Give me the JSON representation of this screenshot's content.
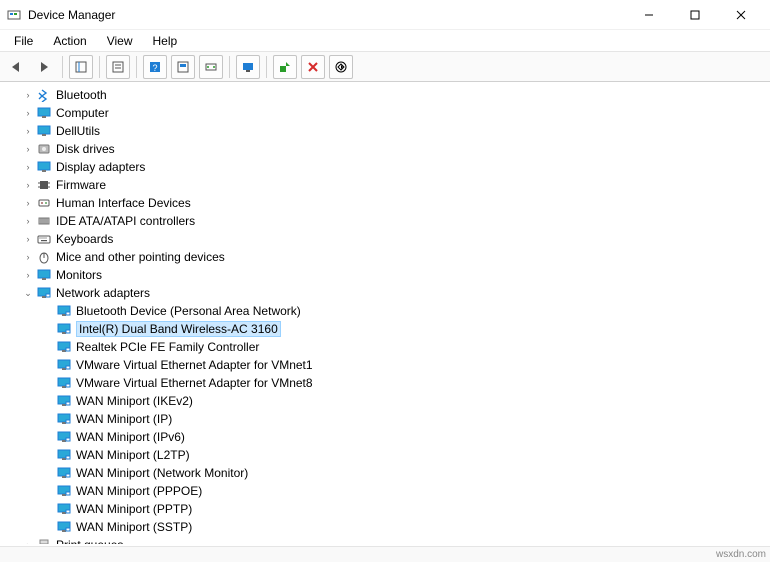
{
  "window": {
    "title": "Device Manager"
  },
  "menubar": {
    "file": "File",
    "action": "Action",
    "view": "View",
    "help": "Help"
  },
  "tree": {
    "categories": [
      {
        "label": "Bluetooth",
        "icon": "bluetooth",
        "expanded": false
      },
      {
        "label": "Computer",
        "icon": "monitor",
        "expanded": false
      },
      {
        "label": "DellUtils",
        "icon": "monitor",
        "expanded": false
      },
      {
        "label": "Disk drives",
        "icon": "disk",
        "expanded": false
      },
      {
        "label": "Display adapters",
        "icon": "monitor",
        "expanded": false
      },
      {
        "label": "Firmware",
        "icon": "chip",
        "expanded": false
      },
      {
        "label": "Human Interface Devices",
        "icon": "hid",
        "expanded": false
      },
      {
        "label": "IDE ATA/ATAPI controllers",
        "icon": "ide",
        "expanded": false
      },
      {
        "label": "Keyboards",
        "icon": "keyboard",
        "expanded": false
      },
      {
        "label": "Mice and other pointing devices",
        "icon": "mouse",
        "expanded": false
      },
      {
        "label": "Monitors",
        "icon": "monitor",
        "expanded": false
      },
      {
        "label": "Network adapters",
        "icon": "network",
        "expanded": true,
        "children": [
          {
            "label": "Bluetooth Device (Personal Area Network)",
            "selected": false
          },
          {
            "label": "Intel(R) Dual Band Wireless-AC 3160",
            "selected": true
          },
          {
            "label": "Realtek PCIe FE Family Controller",
            "selected": false
          },
          {
            "label": "VMware Virtual Ethernet Adapter for VMnet1",
            "selected": false
          },
          {
            "label": "VMware Virtual Ethernet Adapter for VMnet8",
            "selected": false
          },
          {
            "label": "WAN Miniport (IKEv2)",
            "selected": false
          },
          {
            "label": "WAN Miniport (IP)",
            "selected": false
          },
          {
            "label": "WAN Miniport (IPv6)",
            "selected": false
          },
          {
            "label": "WAN Miniport (L2TP)",
            "selected": false
          },
          {
            "label": "WAN Miniport (Network Monitor)",
            "selected": false
          },
          {
            "label": "WAN Miniport (PPPOE)",
            "selected": false
          },
          {
            "label": "WAN Miniport (PPTP)",
            "selected": false
          },
          {
            "label": "WAN Miniport (SSTP)",
            "selected": false
          }
        ]
      },
      {
        "label": "Print queues",
        "icon": "printer",
        "expanded": false
      }
    ]
  },
  "footer": {
    "watermark": "wsxdn.com"
  }
}
